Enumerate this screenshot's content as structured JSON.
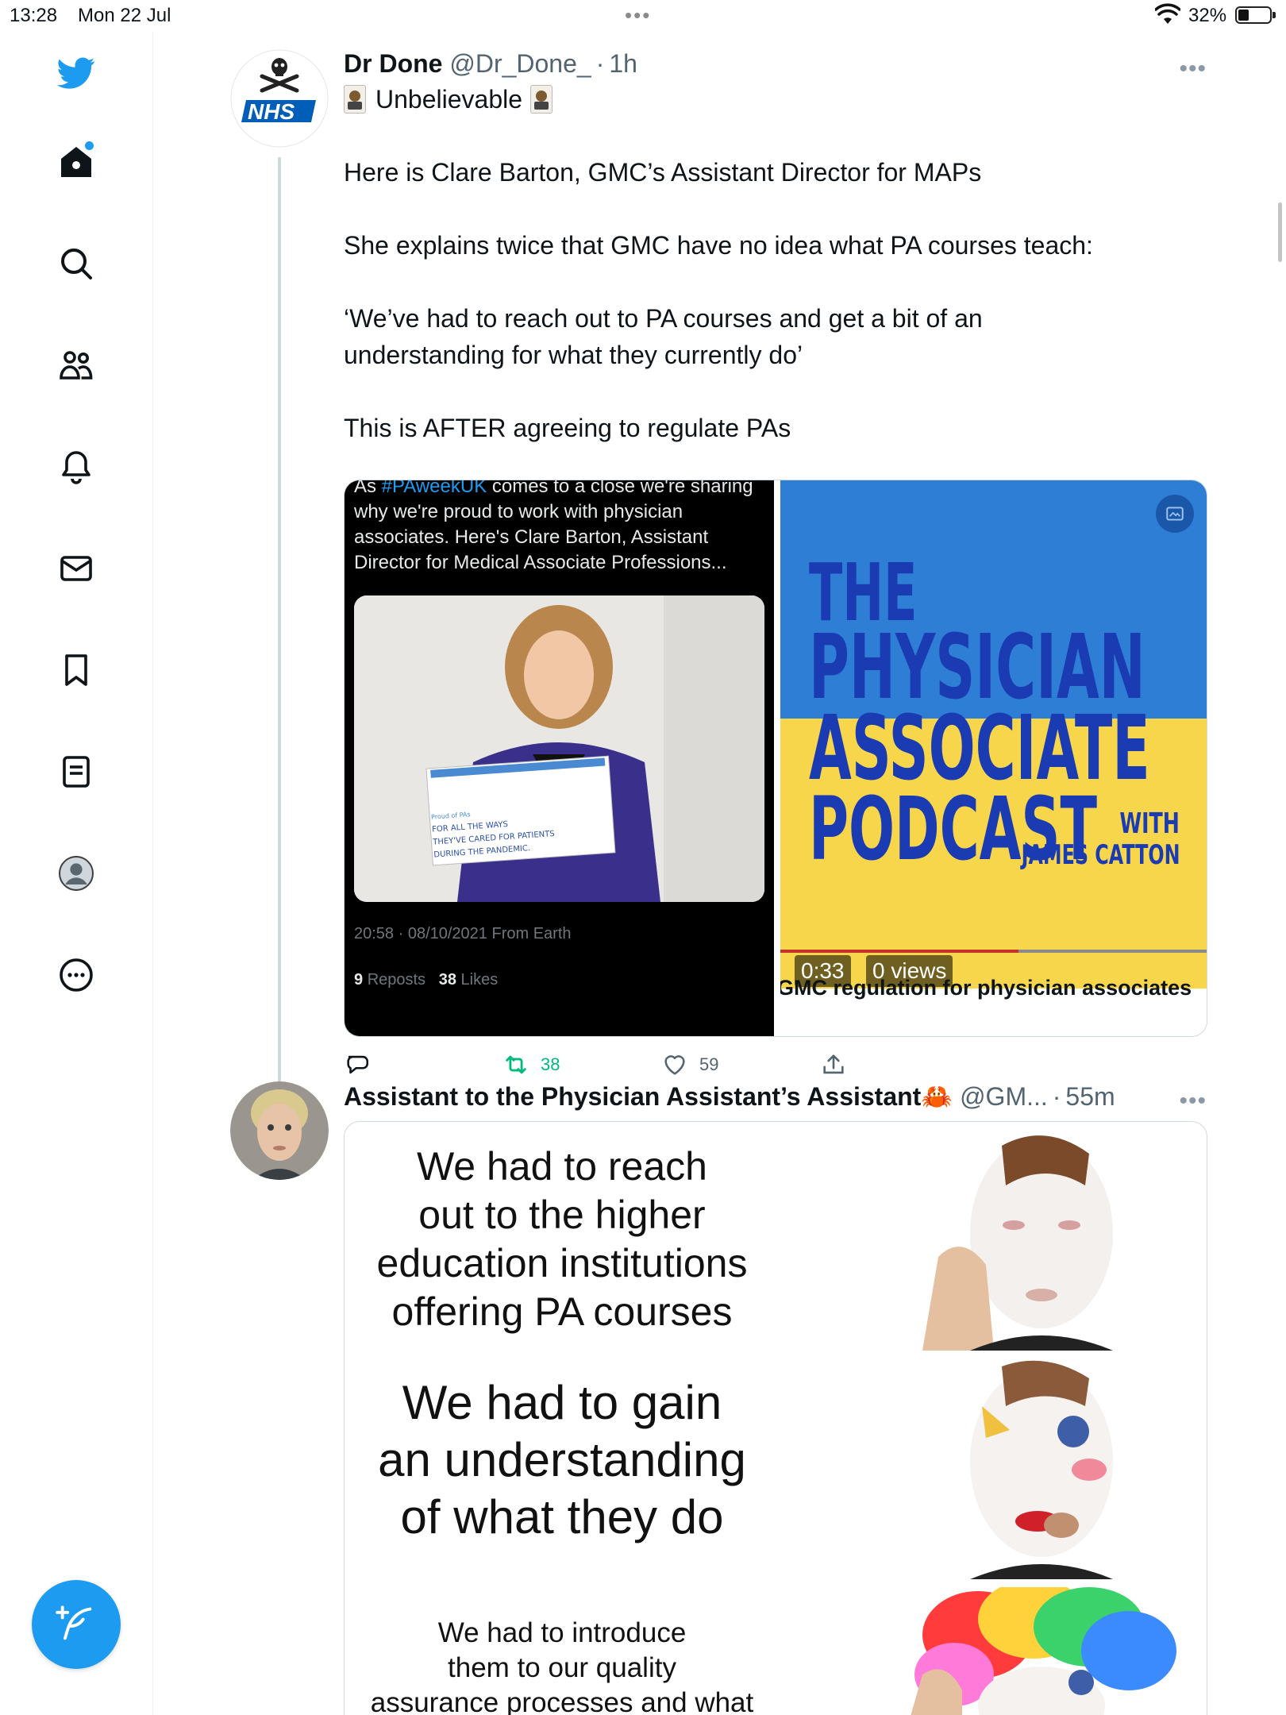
{
  "status_bar": {
    "time": "13:28",
    "date": "Mon 22 Jul",
    "battery": "32%"
  },
  "tweet1": {
    "name": "Dr Done",
    "handle": "@Dr_Done_",
    "sep": "·",
    "ago": "1h",
    "avatar_text": "NHS",
    "lines": {
      "l1": "Unbelievable",
      "l2": "Here is Clare Barton, GMC’s Assistant Director for MAPs",
      "l3": "She explains twice that GMC have no idea what PA courses teach:",
      "l4": "‘We’ve had to reach out to PA courses and get a bit of an\nunderstanding for what they currently do’",
      "l5": "This is AFTER agreeing to regulate PAs"
    },
    "quote_left": {
      "text_pre": "As ",
      "hashtag": "#PAweekUK",
      "text_post": " comes to a close we're sharing why we're proud to work with physician associates. Here's Clare Barton, Assistant Director for Medical Associate Professions...",
      "sign_title": "Proud of PAs",
      "sign_text": "FOR ALL THE WAYS\nTHEY'VE CARED FOR PATIENTS\nDURING THE PANDEMIC.",
      "timestamp": "20:58 · 08/10/2021 From Earth",
      "reposts_count": "9",
      "reposts_label": "Reposts",
      "likes_count": "38",
      "likes_label": "Likes"
    },
    "podcast": {
      "line1": "THE",
      "line2": "PHYSICIAN",
      "line3": "ASSOCIATE",
      "line4": "PODCAST",
      "with": "WITH",
      "host": "JAMES CATTON",
      "duration": "0:33",
      "views": "0 views",
      "caption": "GMC regulation for physician associates"
    },
    "actions": {
      "reply": "",
      "retweets": "38",
      "likes": "59"
    }
  },
  "tweet2": {
    "name": "Assistant to the Physician Assistant’s Assistant",
    "emoji": "🦀",
    "handle": "@GM...",
    "sep": "·",
    "ago": "55m",
    "meme": {
      "panel1": "We had to reach\nout to the higher\neducation institutions\noffering PA courses",
      "panel2": "We had to gain\nan understanding\nof what they do",
      "panel3": "We had to introduce\nthem to our quality\nassurance processes and what"
    }
  },
  "colors": {
    "accent": "#1d9bf0",
    "retweet": "#00ba7c",
    "muted": "#536471",
    "podcast_blue": "#2e7ed6",
    "podcast_yellow": "#f7d64b"
  },
  "icons": [
    "twitter-bird-icon",
    "home-icon",
    "search-icon",
    "communities-icon",
    "bell-icon",
    "mail-icon",
    "bookmark-icon",
    "lists-icon",
    "profile-icon",
    "more-circle-icon",
    "compose-icon"
  ]
}
